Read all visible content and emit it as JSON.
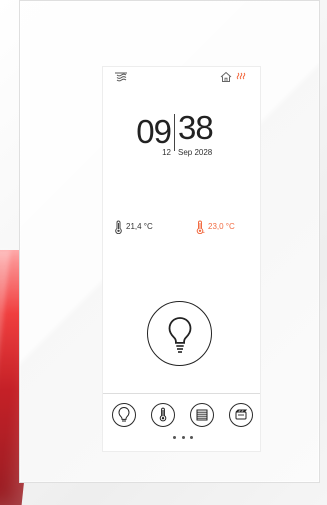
{
  "status": {
    "left_icon": "ventilation-icon",
    "home_icon": "home-icon",
    "heat_icon": "heating-wave-icon"
  },
  "clock": {
    "hour": "09",
    "minute": "38",
    "day": "12",
    "month_year": "Sep 2028"
  },
  "temperatures": {
    "indoor": "21,4 °C",
    "setpoint": "23,0 °C"
  },
  "controls": {
    "main_button_icon": "light-bulb-icon",
    "bottom_nav": [
      "light-bulb-icon",
      "thermometer-icon",
      "blind-icon",
      "scene-icon"
    ]
  },
  "colors": {
    "accent_red": "#f26b42",
    "text_dark": "#222222",
    "decor_red": "#c10f16"
  }
}
